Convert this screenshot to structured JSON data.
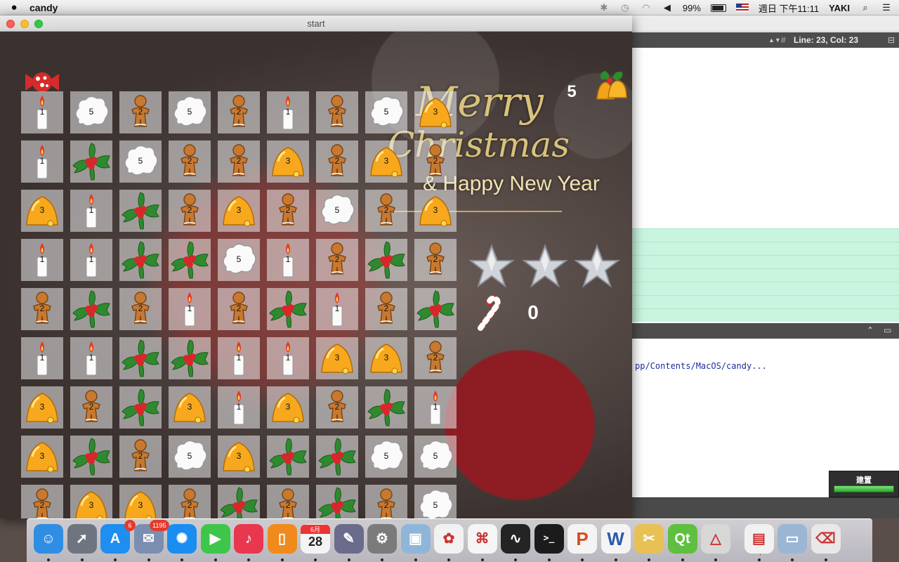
{
  "menubar": {
    "app_name": "candy",
    "battery": "99%",
    "clock": "週日 下午11:11",
    "user": "YAKI",
    "icons": [
      "apple-icon",
      "bluetooth-icon",
      "time-machine-icon",
      "wifi-icon",
      "volume-icon",
      "battery-icon",
      "us-flag-icon",
      "spotlight-icon",
      "notification-center-icon"
    ]
  },
  "editor": {
    "cursor_position": "Line: 23, Col: 23",
    "output_line": "pp/Contents/MacOS/candy...",
    "build_label": "建置"
  },
  "game_window": {
    "title": "start",
    "moves_left": "5",
    "candy_cane_count": "0",
    "stars": 3,
    "greeting_line1": "Merry",
    "greeting_line2": "Christmas",
    "greeting_line3": "& Happy New Year"
  },
  "tile_types": {
    "1": {
      "name": "candle",
      "label": "1"
    },
    "2": {
      "name": "gingerbread",
      "label": "2"
    },
    "3": {
      "name": "bell",
      "label": "3"
    },
    "4": {
      "name": "holly",
      "label": ""
    },
    "5": {
      "name": "popcorn",
      "label": "5"
    }
  },
  "board": [
    [
      1,
      5,
      2,
      5,
      2,
      1,
      2,
      5,
      3
    ],
    [
      1,
      4,
      5,
      2,
      2,
      3,
      2,
      3,
      2
    ],
    [
      3,
      1,
      4,
      2,
      3,
      2,
      5,
      2,
      3
    ],
    [
      1,
      1,
      4,
      4,
      5,
      1,
      2,
      4,
      2
    ],
    [
      2,
      4,
      2,
      1,
      2,
      4,
      1,
      2,
      4
    ],
    [
      1,
      1,
      4,
      4,
      1,
      1,
      3,
      3,
      2
    ],
    [
      3,
      2,
      4,
      3,
      1,
      3,
      2,
      4,
      1
    ],
    [
      3,
      4,
      2,
      5,
      3,
      4,
      4,
      5,
      5
    ],
    [
      2,
      3,
      3,
      2,
      4,
      2,
      4,
      2,
      5
    ]
  ],
  "dock": {
    "items": [
      {
        "name": "finder",
        "color": "#2f8de4",
        "badge": ""
      },
      {
        "name": "launchpad",
        "color": "#6f7580",
        "badge": ""
      },
      {
        "name": "app-store",
        "color": "#1e8ef0",
        "badge": "6"
      },
      {
        "name": "mail",
        "color": "#7a8fb0",
        "badge": "1195"
      },
      {
        "name": "safari",
        "color": "#1a8df0",
        "badge": ""
      },
      {
        "name": "facetime",
        "color": "#3ec64a",
        "badge": ""
      },
      {
        "name": "itunes",
        "color": "#e8374f",
        "badge": ""
      },
      {
        "name": "ibooks",
        "color": "#f08a1c",
        "badge": ""
      },
      {
        "name": "calendar",
        "color": "#f4f4f4",
        "badge": ""
      },
      {
        "name": "script-editor",
        "color": "#6b6b8c",
        "badge": ""
      },
      {
        "name": "system-preferences",
        "color": "#7b7b7b",
        "badge": ""
      },
      {
        "name": "preview",
        "color": "#8fb6d9",
        "badge": ""
      },
      {
        "name": "photos",
        "color": "#f2f2f2",
        "badge": ""
      },
      {
        "name": "acrobat",
        "color": "#f5f5f5",
        "badge": ""
      },
      {
        "name": "activity-monitor",
        "color": "#242424",
        "badge": ""
      },
      {
        "name": "terminal",
        "color": "#1b1b1b",
        "badge": ""
      },
      {
        "name": "powerpoint",
        "color": "#f4f4f4",
        "badge": ""
      },
      {
        "name": "word",
        "color": "#f4f4f4",
        "badge": ""
      },
      {
        "name": "archive-utility",
        "color": "#e8c155",
        "badge": ""
      },
      {
        "name": "qt-creator",
        "color": "#5fbf3f",
        "badge": ""
      },
      {
        "name": "grapher",
        "color": "#d7d7d7",
        "badge": ""
      },
      {
        "name": "rar-document",
        "color": "#f1f1f1",
        "badge": ""
      },
      {
        "name": "downloads-folder",
        "color": "#9bb6d4",
        "badge": ""
      },
      {
        "name": "trash",
        "color": "#e8e8e8",
        "badge": ""
      }
    ],
    "calendar_month": "6月",
    "calendar_day": "28",
    "terminal_prompt": ">_",
    "qt_glyph": "Qt",
    "word_glyph": "W",
    "powerpoint_glyph": "P"
  },
  "colors": {
    "tile_bg": "#ebebeb",
    "accent_gold": "#d9c27a",
    "candy_red": "#d62b2b"
  }
}
